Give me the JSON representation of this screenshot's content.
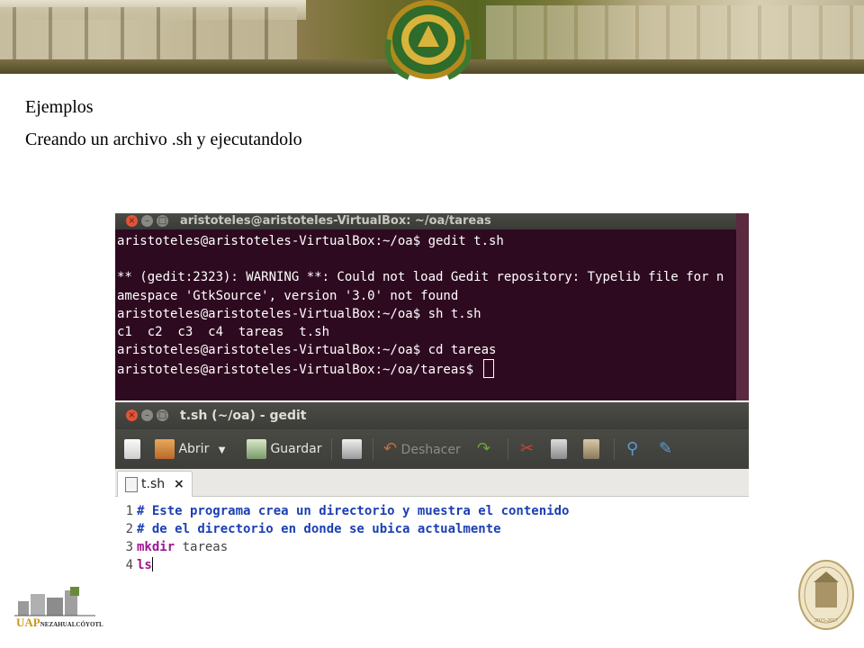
{
  "slide": {
    "heading": "Ejemplos",
    "subheading": "Creando un archivo .sh y ejecutandolo"
  },
  "terminal": {
    "title": "aristoteles@aristoteles-VirtualBox: ~/oa/tareas",
    "lines": [
      "aristoteles@aristoteles-VirtualBox:~/oa$ gedit t.sh",
      "",
      "** (gedit:2323): WARNING **: Could not load Gedit repository: Typelib file for n",
      "amespace 'GtkSource', version '3.0' not found",
      "aristoteles@aristoteles-VirtualBox:~/oa$ sh t.sh",
      "c1  c2  c3  c4  tareas  t.sh",
      "aristoteles@aristoteles-VirtualBox:~/oa$ cd tareas",
      "aristoteles@aristoteles-VirtualBox:~/oa/tareas$ "
    ]
  },
  "gedit": {
    "title": "t.sh (~/oa) - gedit",
    "toolbar": {
      "open_label": "Abrir",
      "save_label": "Guardar",
      "undo_label": "Deshacer"
    },
    "tab": {
      "label": "t.sh",
      "close": "×"
    },
    "code": [
      {
        "num": "1",
        "comment": "# Este programa crea un directorio y muestra el contenido"
      },
      {
        "num": "2",
        "comment": "# de el directorio en donde se ubica actualmente"
      },
      {
        "num": "3",
        "cmd": "mkdir",
        "arg": " tareas"
      },
      {
        "num": "4",
        "cmd": "ls"
      }
    ]
  },
  "footer": {
    "uap_brand": "UAP",
    "uap_campus": "NEZAHUALCÓYOTL",
    "anniv_years": "2015-2017"
  },
  "colors": {
    "terminal_bg": "#2e0a20",
    "comment": "#1b3fb3",
    "keyword": "#a0168f"
  },
  "icons": [
    "new-document-icon",
    "open-folder-icon",
    "save-icon",
    "print-icon",
    "undo-icon",
    "redo-icon",
    "cut-icon",
    "copy-icon",
    "paste-icon",
    "search-icon",
    "replace-icon"
  ]
}
